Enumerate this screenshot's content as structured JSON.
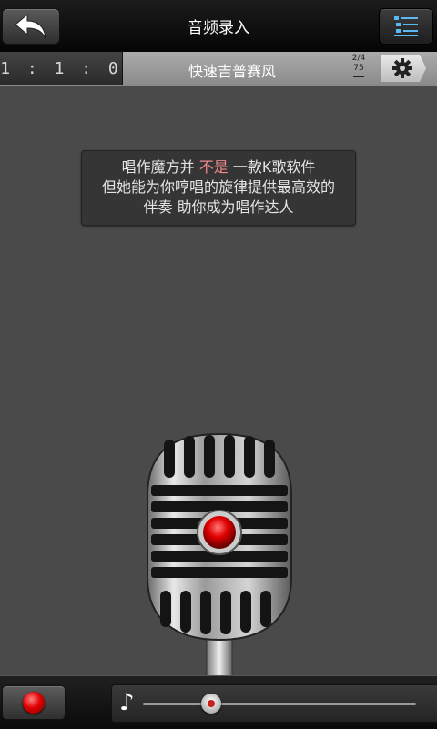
{
  "header": {
    "title": "音频录入",
    "back_icon": "back-arrow-icon",
    "menu_icon": "list-menu-icon"
  },
  "infobar": {
    "time": "1 : 1 : 0",
    "style_name": "快速吉普赛风",
    "fraction_top": "2/4",
    "fraction_bottom": "75",
    "settings_icon": "gear-icon"
  },
  "tip": {
    "line1_a": "唱作魔方并 ",
    "line1_highlight": "不是",
    "line1_b": " 一款K歌软件",
    "line2": "但她能为你哼唱的旋律提供最高效的",
    "line3": "伴奏  助你成为唱作达人"
  },
  "bottom": {
    "record_icon": "record-icon",
    "note_icon": "music-note-icon",
    "note_glyph": "♪",
    "slider_value": 0.25
  },
  "colors": {
    "accent_red": "#e00000",
    "highlight_text": "#f08a8a",
    "menu_icon": "#5bb8f0"
  }
}
